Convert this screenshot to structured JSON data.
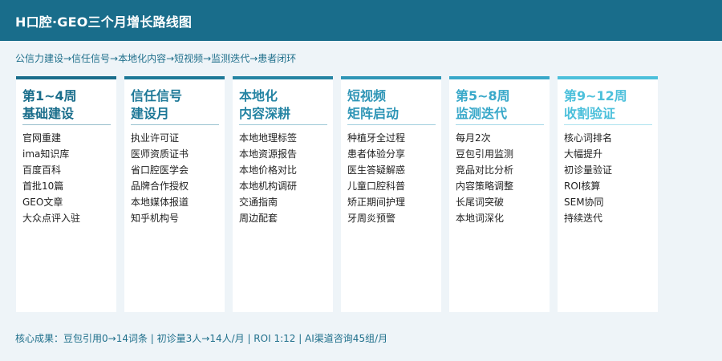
{
  "header": {
    "title": "H口腔·GEO三个月增长路线图"
  },
  "subtitle": "公信力建设→信任信号→本地化内容→短视频→监测迭代→患者闭环",
  "cards": [
    {
      "title": "第1~4周\n基础建设",
      "color": "#196d8b",
      "items": [
        "官网重建",
        "ima知识库",
        "百度百科",
        "首批10篇",
        "GEO文章",
        "大众点评入驻"
      ]
    },
    {
      "title": "信任信号\n建设月",
      "color": "#1d7897",
      "items": [
        "执业许可证",
        "医师资质证书",
        "省口腔医学会",
        "品牌合作授权",
        "本地媒体报道",
        "知乎机构号"
      ]
    },
    {
      "title": "本地化\n内容深耕",
      "color": "#2584a3",
      "items": [
        "本地地理标签",
        "本地资源报告",
        "本地价格对比",
        "本地机构调研",
        "交通指南",
        "周边配套"
      ]
    },
    {
      "title": "短视频\n矩阵启动",
      "color": "#2e95b6",
      "items": [
        "种植牙全过程",
        "患者体验分享",
        "医生答疑解惑",
        "儿童口腔科普",
        "矫正期间护理",
        "牙周炎预警"
      ]
    },
    {
      "title": "第5~8周\n监测迭代",
      "color": "#38a8c9",
      "items": [
        "每月2次",
        "豆包引用监测",
        "竞品对比分析",
        "内容策略调整",
        "长尾词突破",
        "本地词深化"
      ]
    },
    {
      "title": "第9~12周\n收割验证",
      "color": "#4cc0db",
      "items": [
        "核心词排名",
        "大幅提升",
        "初诊量验证",
        "ROI核算",
        "SEM协同",
        "持续迭代"
      ]
    }
  ],
  "footer": "核心成果：豆包引用0→14词条 | 初诊量3人→14人/月 | ROI 1:12 | AI渠道咨询45组/月"
}
